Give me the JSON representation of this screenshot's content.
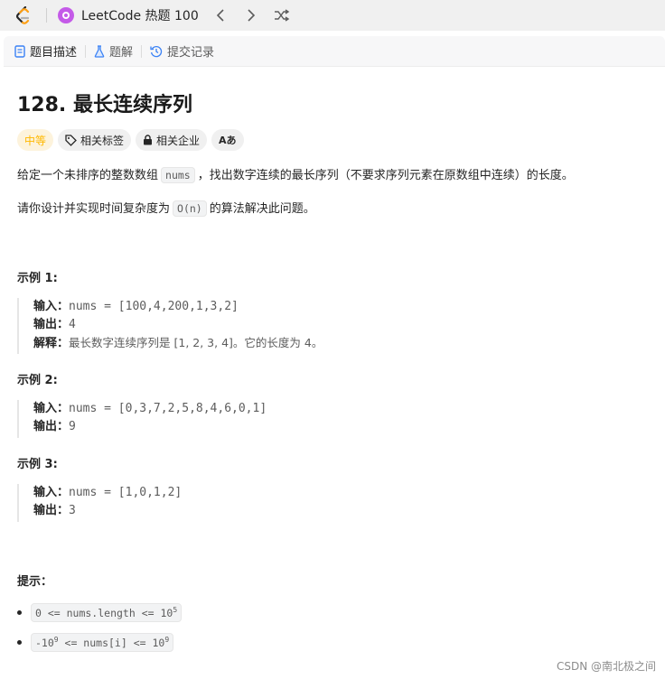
{
  "topbar": {
    "problem_list_title": "LeetCode 热题 100",
    "icons": [
      "leetcode-logo-icon",
      "problem-list-icon",
      "chevron-left-icon",
      "chevron-right-icon",
      "shuffle-icon"
    ]
  },
  "tabs": [
    {
      "label": "题目描述",
      "icon": "description-icon"
    },
    {
      "label": "题解",
      "icon": "flask-icon"
    },
    {
      "label": "提交记录",
      "icon": "history-icon"
    }
  ],
  "problem": {
    "title": "128. 最长连续序列",
    "difficulty": "中等",
    "tag_related": "相关标签",
    "tag_company": "相关企业",
    "translate": "Aあ",
    "desc_1_pre": "给定一个未排序的整数数组",
    "desc_1_code": "nums",
    "desc_1_post": "，找出数字连续的最长序列（不要求序列元素在原数组中连续）的长度。",
    "desc_2_pre": "请你设计并实现时间复杂度为",
    "desc_2_code": "O(n)",
    "desc_2_post": "的算法解决此问题。"
  },
  "examples": [
    {
      "title": "示例 1:",
      "input_label": "输入：",
      "input": "nums = [100,4,200,1,3,2]",
      "output_label": "输出：",
      "output": "4",
      "explain_label": "解释：",
      "explain": "最长数字连续序列是 [1, 2, 3, 4]。它的长度为 4。"
    },
    {
      "title": "示例 2:",
      "input_label": "输入：",
      "input": "nums = [0,3,7,2,5,8,4,6,0,1]",
      "output_label": "输出：",
      "output": "9"
    },
    {
      "title": "示例 3:",
      "input_label": "输入：",
      "input": "nums = [1,0,1,2]",
      "output_label": "输出：",
      "output": "3"
    }
  ],
  "hints": {
    "title": "提示：",
    "c1_main": "0 <= nums.length <= 10",
    "c1_sup": "5",
    "c2_pre": "-10",
    "c2_sup1": "9",
    "c2_mid": " <= nums[i] <= 10",
    "c2_sup2": "9"
  },
  "watermark": "CSDN @南北极之间",
  "colors": {
    "difficulty_medium": "#ffb800",
    "leetcode_orange": "#ffa116",
    "plist_purple": "#c45ae8"
  }
}
